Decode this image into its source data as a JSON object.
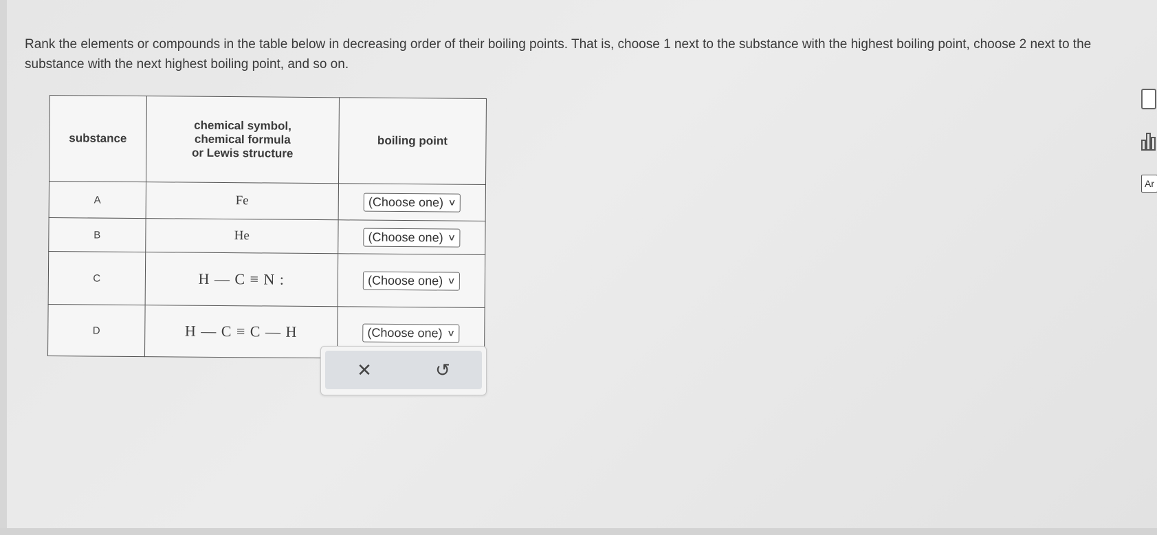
{
  "instructions": "Rank the elements or compounds in the table below in decreasing order of their boiling points. That is, choose 1 next to the substance with the highest boiling point, choose 2 next to the substance with the next highest boiling point, and so on.",
  "table": {
    "headers": {
      "substance": "substance",
      "formula_lines": [
        "chemical symbol,",
        "chemical formula",
        "or Lewis structure"
      ],
      "boiling_point": "boiling point"
    },
    "rows": [
      {
        "substance": "A",
        "formula": "Fe",
        "select": "(Choose one)"
      },
      {
        "substance": "B",
        "formula": "He",
        "select": "(Choose one)"
      },
      {
        "substance": "C",
        "formula": "H — C ≡ N :",
        "select": "(Choose one)"
      },
      {
        "substance": "D",
        "formula": "H — C ≡ C — H",
        "select": "(Choose one)"
      }
    ]
  },
  "actions": {
    "clear_glyph": "✕",
    "reset_glyph": "↺"
  },
  "sidebar_tools": {
    "calculator_icon": "calculator-icon",
    "chart_icon": "data-chart-icon",
    "periodic_table_label": "Ar"
  }
}
